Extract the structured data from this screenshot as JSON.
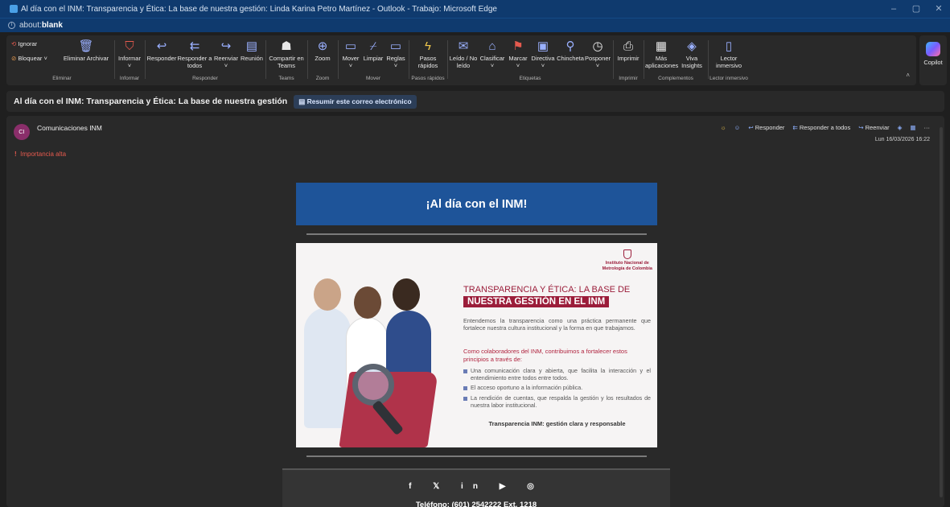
{
  "window": {
    "title": "Al día con el INM: Transparencia y Ética: La base de nuestra gestión: Linda Karina Petro Martínez - Outlook - Trabajo: Microsoft Edge",
    "address_prefix": "about:",
    "address_bold": "blank"
  },
  "ribbon": {
    "groups": {
      "eliminar": "Eliminar",
      "informar": "Informar",
      "responder": "Responder",
      "teams": "Teams",
      "zoom": "Zoom",
      "mover": "Mover",
      "pasos": "Pasos rápidos",
      "etiquetas": "Etiquetas",
      "imprimir": "Imprimir",
      "complementos": "Complementos",
      "lector": "Lector inmersivo"
    },
    "buttons": {
      "ignorar": "Ignorar",
      "bloquear": "Bloquear",
      "eliminar_archivar": "Eliminar Archivar",
      "informar": "Informar",
      "responder": "Responder",
      "responder_todos": "Responder a todos",
      "reenviar": "Reenviar",
      "reunion": "Reunión",
      "compartir_teams": "Compartir en Teams",
      "zoom": "Zoom",
      "mover": "Mover",
      "limpiar": "Limpiar",
      "reglas": "Reglas",
      "pasos_rapidos": "Pasos rápidos",
      "leido": "Leído / No leído",
      "clasificar": "Clasificar",
      "marcar": "Marcar",
      "directiva": "Directiva",
      "chincheta": "Chincheta",
      "posponer": "Posponer",
      "imprimir": "Imprimir",
      "mas_aplicaciones": "Más aplicaciones",
      "viva_insights": "Viva Insights",
      "lector_inmersivo": "Lector inmersivo"
    },
    "copilot": "Copilot"
  },
  "message": {
    "subject": "Al día con el INM: Transparencia y Ética: La base de nuestra gestión",
    "summarize_label": "Resumir este correo electrónico",
    "sender_initials": "CI",
    "sender": "Comunicaciones INM",
    "importance": "Importancia alta",
    "actions": {
      "responder": "Responder",
      "responder_todos": "Responder a todos",
      "reenviar": "Reenviar"
    },
    "date": "Lun 16/03/2026 16:22"
  },
  "email": {
    "banner": "¡Al día con el INM!",
    "card": {
      "logo_text_1": "Instituto Nacional de",
      "logo_text_2": "Metrología de Colombia",
      "title_1": "TRANSPARENCIA Y ÉTICA: LA BASE DE",
      "title_2": "NUESTRA GESTIÓN EN EL INM",
      "intro": "Entendemos la transparencia como una práctica permanente que fortalece nuestra cultura institucional y la forma en que trabajamos.",
      "highlight": "Como colaboradores del INM, contribuimos a fortalecer estos principios a través de:",
      "bullets": [
        "Una comunicación clara y abierta, que facilita la interacción y el entendimiento entre todos entre todos.",
        "El acceso oportuno a la información pública.",
        "La rendición de cuentas, que respalda la gestión y los resultados de nuestra labor institucional."
      ],
      "tagline": "Transparencia INM: gestión clara y responsable"
    },
    "footer": {
      "social": "f  𝕏  in  ▶  ◎",
      "phone": "Teléfono: (601) 2542222 Ext. 1218"
    }
  }
}
